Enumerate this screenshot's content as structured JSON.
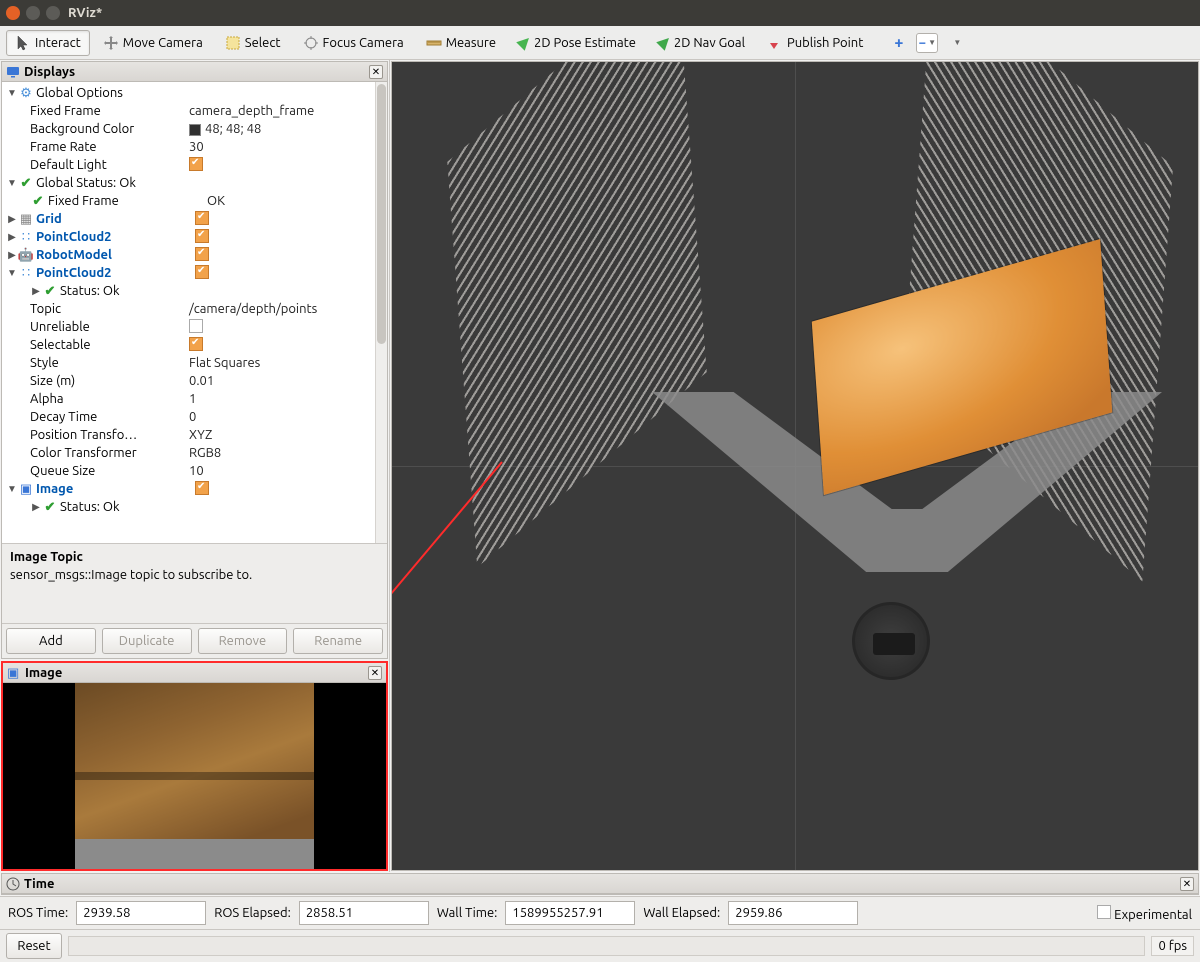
{
  "title": "RViz*",
  "toolbar": {
    "interact": "Interact",
    "move_camera": "Move Camera",
    "select": "Select",
    "focus_camera": "Focus Camera",
    "measure": "Measure",
    "pose_estimate": "2D Pose Estimate",
    "nav_goal": "2D Nav Goal",
    "publish_point": "Publish Point"
  },
  "displays_panel": {
    "title": "Displays"
  },
  "tree": {
    "global_options": {
      "label": "Global Options"
    },
    "fixed_frame": {
      "label": "Fixed Frame",
      "value": "camera_depth_frame"
    },
    "background_color": {
      "label": "Background Color",
      "value": "48; 48; 48"
    },
    "frame_rate": {
      "label": "Frame Rate",
      "value": "30"
    },
    "default_light": {
      "label": "Default Light"
    },
    "global_status": {
      "label": "Global Status: Ok"
    },
    "gs_fixed_frame": {
      "label": "Fixed Frame",
      "value": "OK"
    },
    "grid": {
      "label": "Grid"
    },
    "pointcloud2_a": {
      "label": "PointCloud2"
    },
    "robot_model": {
      "label": "RobotModel"
    },
    "pointcloud2_b": {
      "label": "PointCloud2"
    },
    "pc2_status": {
      "label": "Status: Ok"
    },
    "pc2_topic": {
      "label": "Topic",
      "value": "/camera/depth/points"
    },
    "pc2_unreliable": {
      "label": "Unreliable"
    },
    "pc2_selectable": {
      "label": "Selectable"
    },
    "pc2_style": {
      "label": "Style",
      "value": "Flat Squares"
    },
    "pc2_size": {
      "label": "Size (m)",
      "value": "0.01"
    },
    "pc2_alpha": {
      "label": "Alpha",
      "value": "1"
    },
    "pc2_decay": {
      "label": "Decay Time",
      "value": "0"
    },
    "pc2_pos_tf": {
      "label": "Position Transfo…",
      "value": "XYZ"
    },
    "pc2_col_tf": {
      "label": "Color Transformer",
      "value": "RGB8"
    },
    "pc2_queue": {
      "label": "Queue Size",
      "value": "10"
    },
    "image": {
      "label": "Image"
    },
    "img_status": {
      "label": "Status: Ok"
    }
  },
  "description": {
    "title": "Image Topic",
    "text": "sensor_msgs::Image topic to subscribe to."
  },
  "buttons": {
    "add": "Add",
    "duplicate": "Duplicate",
    "remove": "Remove",
    "rename": "Rename"
  },
  "image_panel": {
    "title": "Image"
  },
  "time_panel": {
    "title": "Time"
  },
  "time": {
    "ros_time_label": "ROS Time:",
    "ros_time": "2939.58",
    "ros_elapsed_label": "ROS Elapsed:",
    "ros_elapsed": "2858.51",
    "wall_time_label": "Wall Time:",
    "wall_time": "1589955257.91",
    "wall_elapsed_label": "Wall Elapsed:",
    "wall_elapsed": "2959.86",
    "experimental": "Experimental"
  },
  "bottom": {
    "reset": "Reset",
    "fps": "0 fps"
  }
}
